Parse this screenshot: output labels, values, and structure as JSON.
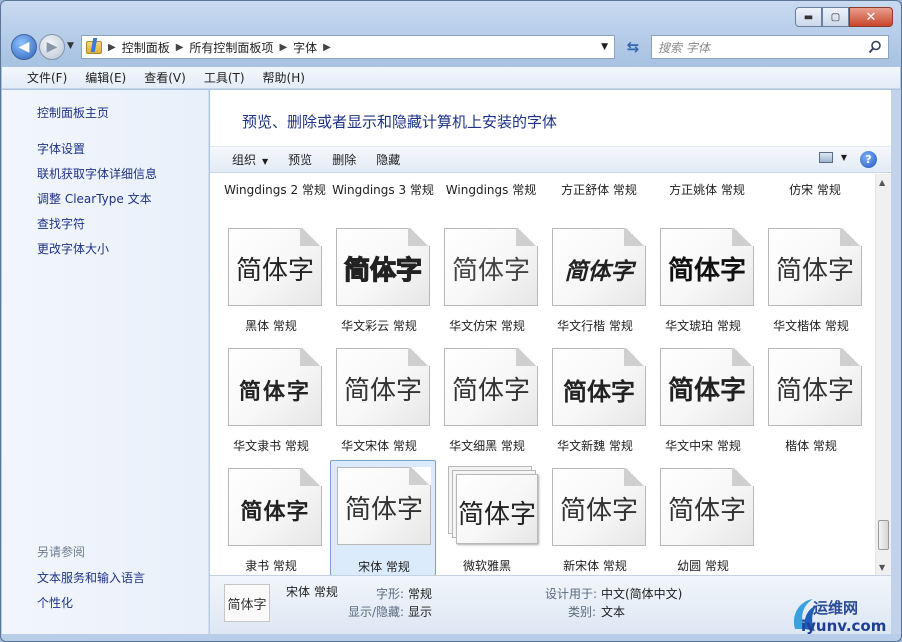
{
  "window": {
    "min_glyph": "▬",
    "max_glyph": "▢",
    "close_glyph": "✕"
  },
  "address": {
    "segments": [
      "控制面板",
      "所有控制面板项",
      "字体"
    ],
    "search_placeholder": "搜索 字体"
  },
  "menu": [
    "文件(F)",
    "编辑(E)",
    "查看(V)",
    "工具(T)",
    "帮助(H)"
  ],
  "sidebar": {
    "home": "控制面板主页",
    "links": [
      "字体设置",
      "联机获取字体详细信息",
      "调整 ClearType 文本",
      "查找字符",
      "更改字体大小"
    ],
    "see_also_title": "另请参阅",
    "see_also": [
      "文本服务和输入语言",
      "个性化"
    ]
  },
  "main": {
    "title": "预览、删除或者显示和隐藏计算机上安装的字体",
    "commands": {
      "organize": "组织",
      "preview": "预览",
      "delete": "删除",
      "hide": "隐藏"
    }
  },
  "fonts": {
    "top_row": [
      "Wingdings 2 常规",
      "Wingdings 3 常规",
      "Wingdings 常规",
      "方正舒体 常规",
      "方正姚体 常规",
      "仿宋 常规"
    ],
    "sample": "简体字",
    "rows": [
      [
        "黑体 常规",
        "华文彩云 常规",
        "华文仿宋 常规",
        "华文行楷 常规",
        "华文琥珀 常规",
        "华文楷体 常规"
      ],
      [
        "华文隶书 常规",
        "华文宋体 常规",
        "华文细黑 常规",
        "华文新魏 常规",
        "华文中宋 常规",
        "楷体 常规"
      ],
      [
        "隶书 常规",
        "宋体 常规",
        "微软雅黑",
        "新宋体 常规",
        "幼圆 常规"
      ]
    ]
  },
  "details": {
    "thumb": "简体字",
    "name": "宋体 常规",
    "style_label": "字形:",
    "style_value": "常规",
    "visibility_label": "显示/隐藏:",
    "visibility_value": "显示",
    "designed_label": "设计用于:",
    "designed_value": "中文(简体中文)",
    "category_label": "类别:",
    "category_value": "文本"
  },
  "watermark": {
    "text": "运维网",
    "url": "iyunv.com"
  }
}
